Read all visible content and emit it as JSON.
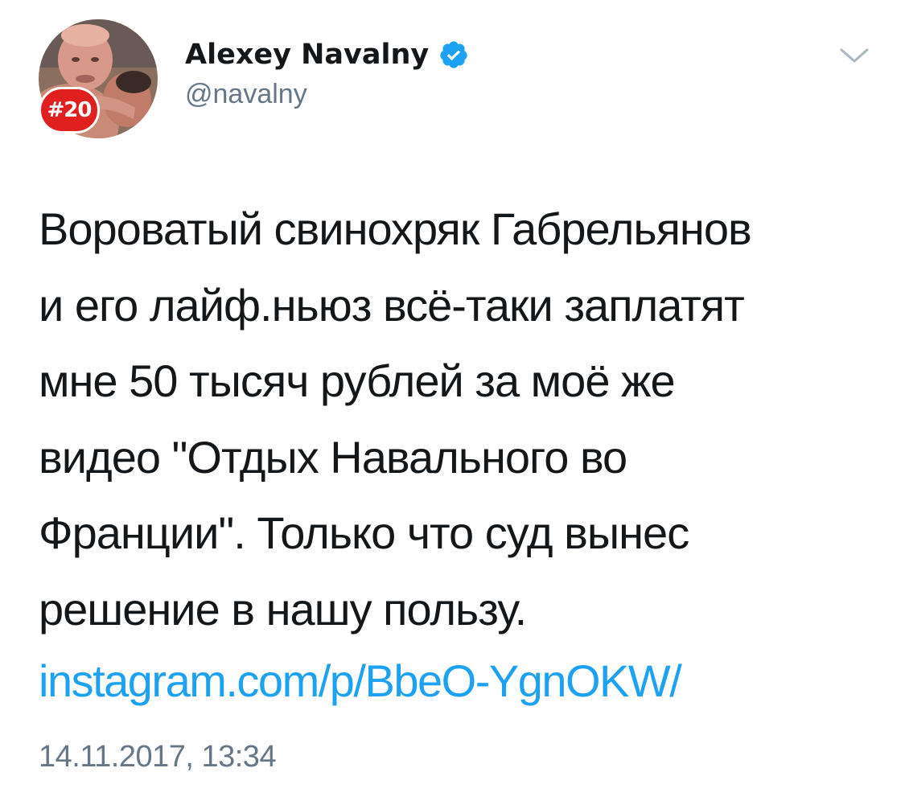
{
  "tweet": {
    "author": {
      "display_name": "Alexey Navalny",
      "handle": "@navalny",
      "verified": true,
      "avatar_badge": "#20"
    },
    "text_lines": [
      "Вороватый свинохряк Габрельянов",
      "и его лайф.ньюз всё-таки заплатят",
      "мне 50 тысяч рублей за моё же",
      "видео \"Отдых Навального во",
      "Франции\". Только что суд вынес",
      "решение в нашу пользу."
    ],
    "link_text": "instagram.com/p/BbeO-YgnOKW/",
    "timestamp": "14.11.2017, 13:34",
    "icons": {
      "verified": "verified-badge-icon",
      "menu": "chevron-down-icon"
    },
    "colors": {
      "link": "#1da1f2",
      "verified": "#1da1f2",
      "secondary_text": "#657786",
      "badge": "#e0201f"
    }
  }
}
